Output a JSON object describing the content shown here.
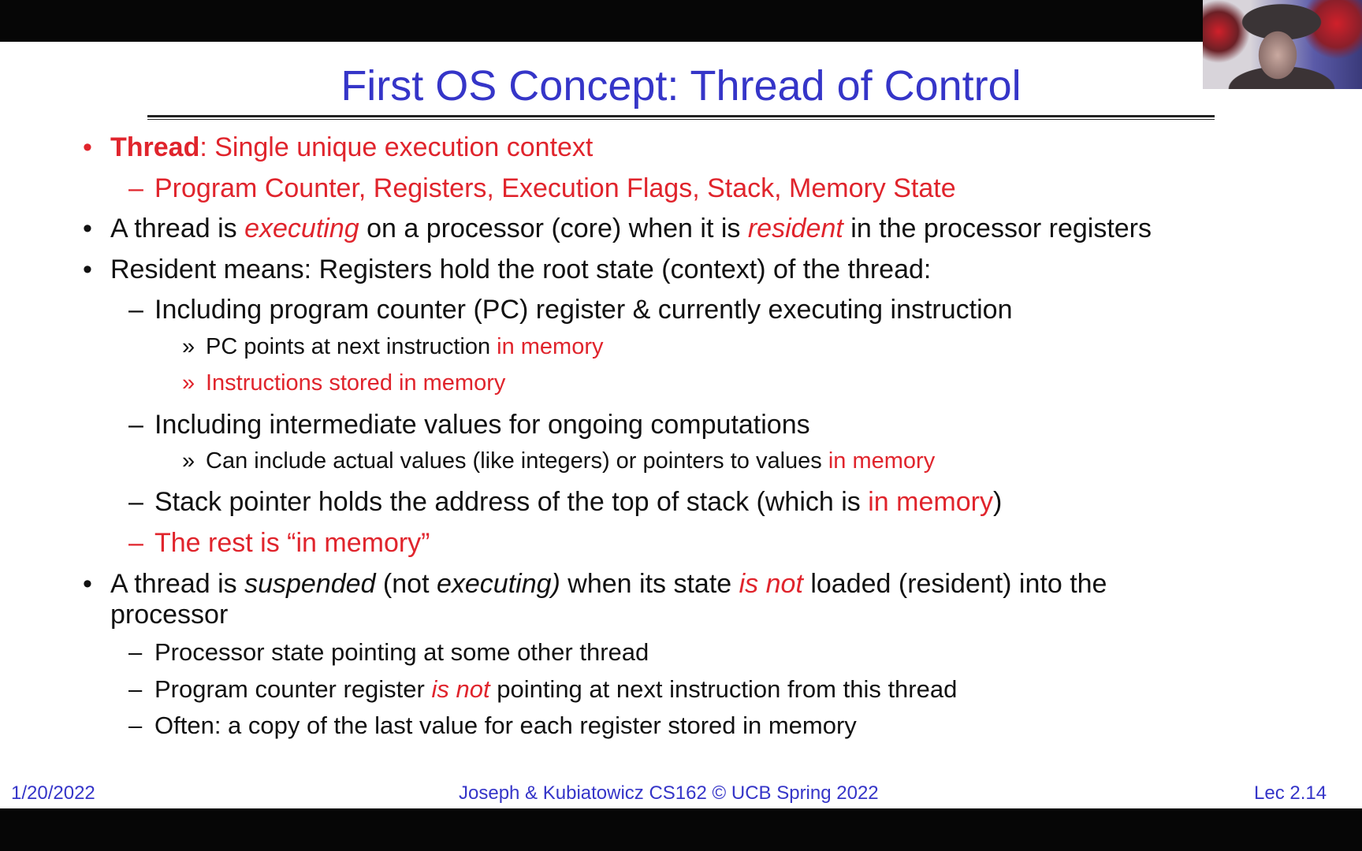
{
  "title": "First OS Concept: Thread of Control",
  "colors": {
    "title": "#3535c8",
    "accent": "#e0242c",
    "text": "#111111"
  },
  "webcam": "presenter-video",
  "lines": [
    {
      "level": 1,
      "marker": "•",
      "red_marker": true,
      "segments": [
        {
          "t": "Thread",
          "s": "red b"
        },
        {
          "t": ": Single unique execution context",
          "s": "red"
        }
      ]
    },
    {
      "level": 2,
      "marker": "–",
      "red_marker": true,
      "segments": [
        {
          "t": "Program Counter, Registers, Execution Flags, Stack, Memory State",
          "s": "red"
        }
      ]
    },
    {
      "level": 1,
      "marker": "•",
      "segments": [
        {
          "t": "A thread is "
        },
        {
          "t": "executing",
          "s": "red i"
        },
        {
          "t": " on a processor (core) when it is "
        },
        {
          "t": "resident",
          "s": "red i"
        },
        {
          "t": " in the processor registers"
        }
      ]
    },
    {
      "level": 1,
      "marker": "•",
      "segments": [
        {
          "t": "Resident means: Registers hold the root state (context) of the thread:"
        }
      ]
    },
    {
      "level": 2,
      "marker": "–",
      "segments": [
        {
          "t": "Including program counter (PC) register & currently executing instruction"
        }
      ]
    },
    {
      "level": 3,
      "marker": "»",
      "segments": [
        {
          "t": "PC points at next instruction "
        },
        {
          "t": "in memory",
          "s": "red"
        }
      ]
    },
    {
      "level": 3,
      "marker": "»",
      "red_marker": true,
      "segments": [
        {
          "t": "Instructions stored in memory",
          "s": "red"
        }
      ]
    },
    {
      "level": 2,
      "marker": "–",
      "segments": [
        {
          "t": "Including intermediate values for ongoing computations"
        }
      ]
    },
    {
      "level": 3,
      "marker": "»",
      "segments": [
        {
          "t": "Can include actual values (like integers) or pointers to values "
        },
        {
          "t": "in memory",
          "s": "red"
        }
      ]
    },
    {
      "level": 2,
      "marker": "–",
      "segments": [
        {
          "t": "Stack pointer holds the address of the top of stack (which is "
        },
        {
          "t": "in memory",
          "s": "red"
        },
        {
          "t": ")"
        }
      ]
    },
    {
      "level": 2,
      "marker": "–",
      "red_marker": true,
      "segments": [
        {
          "t": "The rest is “in memory”",
          "s": "red"
        }
      ]
    },
    {
      "level": 1,
      "marker": "•",
      "segments": [
        {
          "t": "A thread is "
        },
        {
          "t": "suspended",
          "s": "i"
        },
        {
          "t": " (not "
        },
        {
          "t": "executing)",
          "s": "i"
        },
        {
          "t": " when its state "
        },
        {
          "t": "is not",
          "s": "red i"
        },
        {
          "t": " loaded (resident) into the"
        }
      ]
    },
    {
      "level": 1,
      "marker": "",
      "segments": [
        {
          "t": "processor"
        }
      ]
    },
    {
      "level": 2,
      "marker": "–",
      "small": true,
      "segments": [
        {
          "t": "Processor state pointing at some other thread"
        }
      ]
    },
    {
      "level": 2,
      "marker": "–",
      "small": true,
      "segments": [
        {
          "t": "Program counter register "
        },
        {
          "t": "is not",
          "s": "red i"
        },
        {
          "t": " pointing at next instruction from this thread"
        }
      ]
    },
    {
      "level": 2,
      "marker": "–",
      "small": true,
      "segments": [
        {
          "t": "Often: a copy of the last value for each register stored in memory"
        }
      ]
    }
  ],
  "footer": {
    "date": "1/20/2022",
    "center": "Joseph & Kubiatowicz CS162 © UCB Spring 2022",
    "page": "Lec 2.14"
  }
}
